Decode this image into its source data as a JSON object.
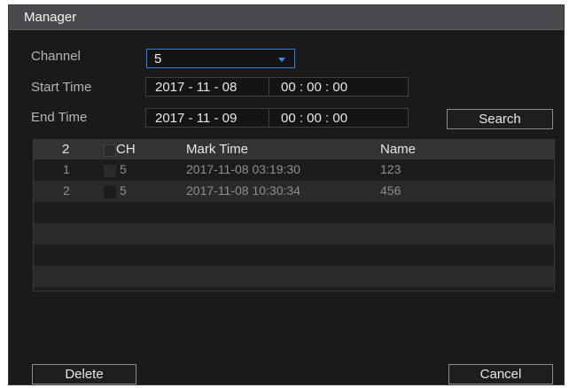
{
  "window": {
    "title": "Manager"
  },
  "form": {
    "channel_label": "Channel",
    "channel_value": "5",
    "start_label": "Start Time",
    "start_date": "2017 - 11 - 08",
    "start_time": "00 : 00 : 00",
    "end_label": "End Time",
    "end_date": "2017 - 11 - 09",
    "end_time": "00 : 00 : 00",
    "search_label": "Search"
  },
  "table": {
    "count": "2",
    "headers": {
      "ch": "CH",
      "mark_time": "Mark Time",
      "name": "Name"
    },
    "rows": [
      {
        "index": "1",
        "ch": "5",
        "mark_time": "2017-11-08 03:19:30",
        "name": "123"
      },
      {
        "index": "2",
        "ch": "5",
        "mark_time": "2017-11-08 10:30:34",
        "name": "456"
      }
    ]
  },
  "footer": {
    "delete_label": "Delete",
    "cancel_label": "Cancel"
  },
  "colors": {
    "accent": "#2e7fd6",
    "background": "#1a1a1d",
    "titlebar": "#4a4a4e"
  }
}
